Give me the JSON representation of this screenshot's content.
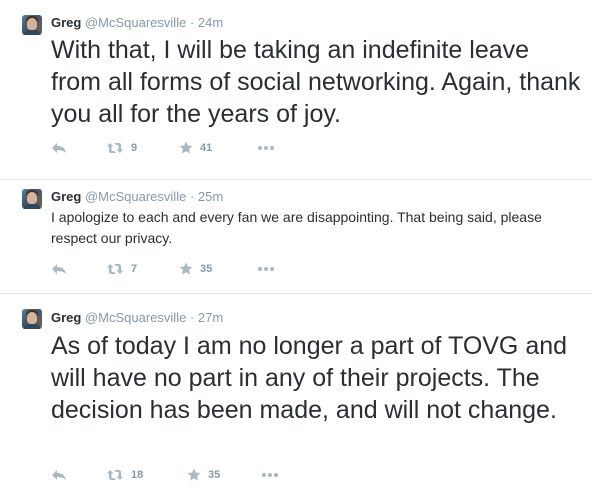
{
  "tweets": [
    {
      "author_name": "Greg",
      "handle": "@McSquaresville",
      "separator": "·",
      "time": "24m",
      "text": "With that, I will be taking an indefinite leave from all forms of social networking. Again, thank you all for the years of joy.",
      "retweets": "9",
      "favorites": "41"
    },
    {
      "author_name": "Greg",
      "handle": "@McSquaresville",
      "separator": "·",
      "time": "25m",
      "text": "I apologize to each and every fan we are disappointing. That being said, please respect our privacy.",
      "retweets": "7",
      "favorites": "35"
    },
    {
      "author_name": "Greg",
      "handle": "@McSquaresville",
      "separator": "·",
      "time": "27m",
      "text": "As of today I am no longer a part of TOVG and will have no part in any of their projects. The decision has been made, and will not change.",
      "retweets": "18",
      "favorites": "35"
    }
  ],
  "icons": {
    "reply": "reply-icon",
    "retweet": "retweet-icon",
    "favorite": "star-icon",
    "more": "more-icon"
  },
  "colors": {
    "text": "#292f33",
    "muted": "#8899a6",
    "divider": "#e1e8ed"
  }
}
